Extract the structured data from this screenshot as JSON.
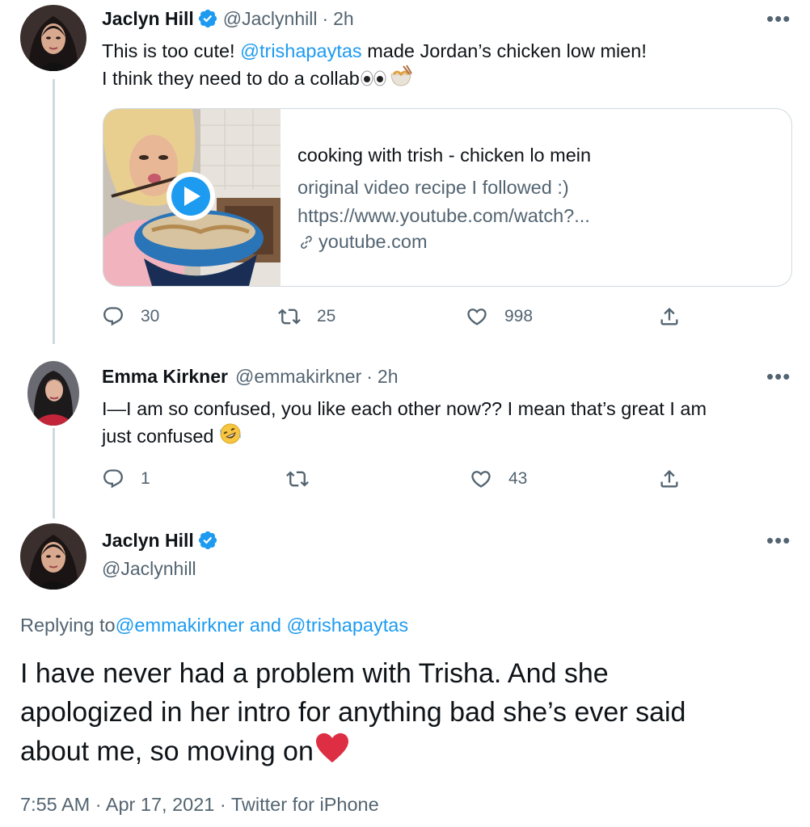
{
  "tweet1": {
    "display_name": "Jaclyn Hill",
    "handle": "@Jaclynhill",
    "separator": "·",
    "time": "2h",
    "text_prefix": "This is too cute! ",
    "mention": "@trishapaytas",
    "text_rest": " made Jordan’s chicken low mien!",
    "text_line2": "I think they need to do a collab",
    "card": {
      "title": "cooking with trish - chicken lo mein",
      "description_line1": "original video recipe I followed :)",
      "description_line2": "https://www.youtube.com/watch?...",
      "domain": "youtube.com"
    },
    "reply_count": "30",
    "retweet_count": "25",
    "like_count": "998"
  },
  "tweet2": {
    "display_name": "Emma Kirkner",
    "handle": "@emmakirkner",
    "separator": "·",
    "time": "2h",
    "text_line1": "I—I am so confused, you like each other now?? I mean that’s great I am",
    "text_line2": "just confused",
    "reply_count": "1",
    "retweet_count": "",
    "like_count": "43"
  },
  "tweet3": {
    "display_name": "Jaclyn Hill",
    "handle": "@Jaclynhill",
    "replying_label": "Replying to ",
    "reply_mention1": "@emmakirkner",
    "reply_and": " and ",
    "reply_mention2": "@trishapaytas",
    "text_line1": "I have never had a problem with Trisha. And she",
    "text_line2": "apologized in her intro for anything bad she’s ever said",
    "text_line3": "about me, so moving on",
    "timestamp": "7:55 AM · Apr 17, 2021 · Twitter for iPhone"
  },
  "more_label": "•••",
  "colors": {
    "accent": "#1d9bf0",
    "secondary_text": "#536471",
    "verified": "#1d9bf0"
  }
}
